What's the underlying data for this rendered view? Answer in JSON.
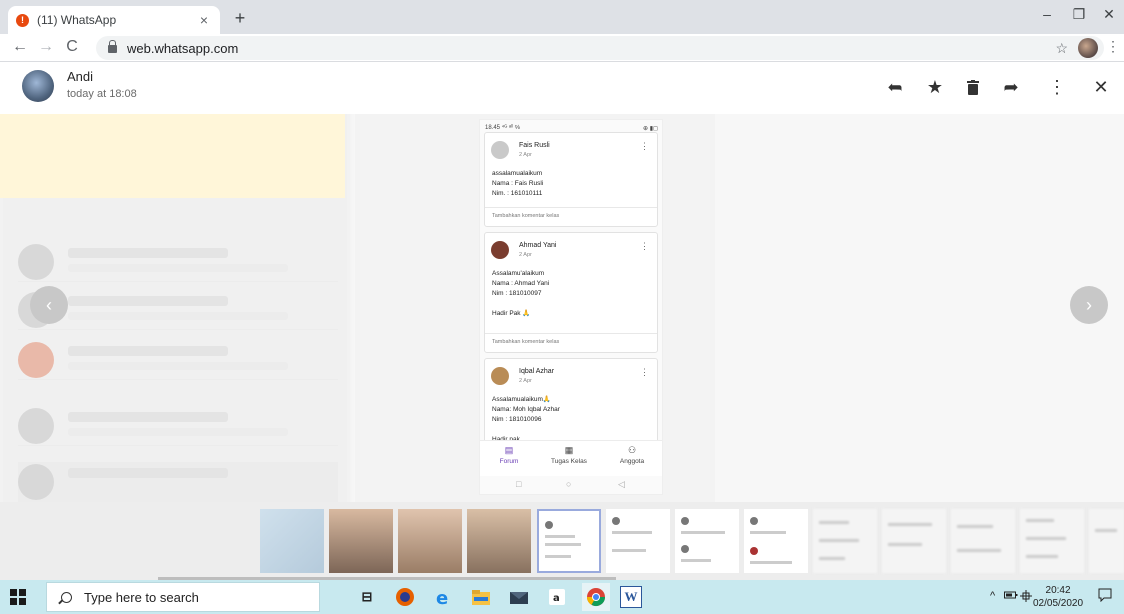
{
  "browser": {
    "tab_title": "(11) WhatsApp",
    "tab_badge": "!",
    "tab_close": "×",
    "new_tab": "+",
    "url": "web.whatsapp.com",
    "window_minimize": "–",
    "window_restore": "❐",
    "window_close": "✕",
    "back": "←",
    "forward": "→",
    "reload": "C",
    "bookmark_star": "☆",
    "menu": "⋮"
  },
  "viewer": {
    "sender_name": "Andi",
    "timestamp": "today at 18:08",
    "actions": {
      "reply": "➦",
      "star": "★",
      "delete": "🗑",
      "forward": "➦",
      "menu": "⋮",
      "close": "✕"
    },
    "prev_arrow": "‹",
    "next_arrow": "›"
  },
  "phone": {
    "status_time": "18.45 ⁴ᴳ ᵃˡˡ ℅",
    "status_right": "⊕ ▮◻",
    "posts": [
      {
        "name": "Fais Rusli",
        "date": "2 Apr",
        "lines": [
          "assalamualaikum",
          "Nama : Fais Rusli",
          "Nim.   : 161010111"
        ],
        "comment": "Tambahkan komentar kelas",
        "avatar_color": "#c9c9c9"
      },
      {
        "name": "Ahmad Yani",
        "date": "2 Apr",
        "lines": [
          "Assalamu'alaikum",
          "Nama : Ahmad Yani",
          "Nim : 181010097",
          "",
          "Hadir Pak 🙏"
        ],
        "comment": "Tambahkan komentar kelas",
        "avatar_color": "#7a3d2f"
      },
      {
        "name": "Iqbal Azhar",
        "date": "2 Apr",
        "lines": [
          "Assalamualaikum🙏",
          "Nama: Moh Iqbal Azhar",
          "Nim : 181010096",
          "",
          "Hadir pak"
        ],
        "avatar_color": "#b98c56"
      }
    ],
    "more": "⋮",
    "nav": [
      {
        "label": "Forum",
        "icon": "▤"
      },
      {
        "label": "Tugas Kelas",
        "icon": "▦"
      },
      {
        "label": "Anggota",
        "icon": "⚇"
      }
    ],
    "sys_buttons": [
      "□",
      "○",
      "◁"
    ]
  },
  "taskbar": {
    "search_placeholder": "Type here to search",
    "time": "20:42",
    "date": "02/05/2020",
    "tray_caret": "^",
    "icons": {
      "taskview": "⊟",
      "word": "W"
    }
  },
  "colors": {
    "accent_purple": "#6a3fb5",
    "taskbar_bg": "#c8e9ef",
    "tab_badge": "#e8490f"
  }
}
